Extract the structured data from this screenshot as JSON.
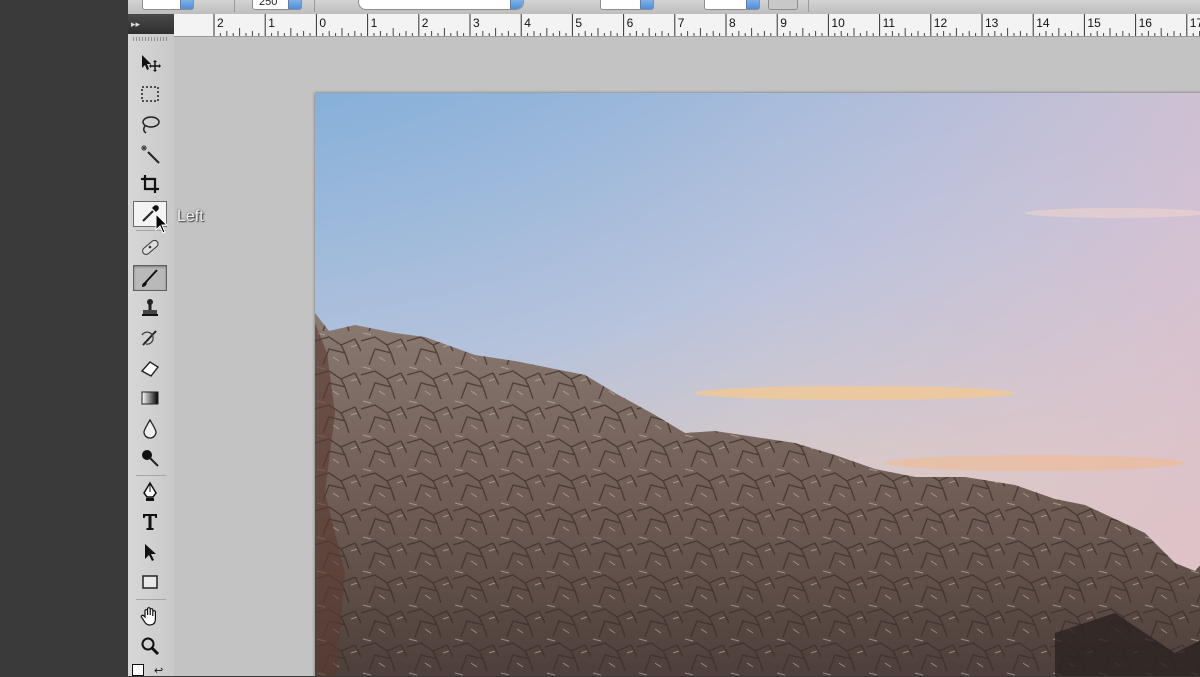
{
  "options_bar": {
    "brush_size_value": "250"
  },
  "ruler": {
    "unit": "inches",
    "labels": [
      "2",
      "1",
      "0",
      "1",
      "2",
      "3",
      "4",
      "5",
      "6",
      "7",
      "8",
      "9",
      "10",
      "11",
      "12",
      "13",
      "14",
      "15",
      "16",
      "17"
    ]
  },
  "toolbox": {
    "tools": [
      {
        "name": "move-tool",
        "icon": "move-icon",
        "state": "normal"
      },
      {
        "name": "marquee-tool",
        "icon": "rect-marquee-icon",
        "state": "normal"
      },
      {
        "name": "lasso-tool",
        "icon": "lasso-icon",
        "state": "normal"
      },
      {
        "name": "magic-wand-tool",
        "icon": "magic-wand-icon",
        "state": "normal"
      },
      {
        "name": "crop-tool",
        "icon": "crop-icon",
        "state": "normal"
      },
      {
        "name": "eyedropper-tool",
        "icon": "eyedropper-icon",
        "state": "hover"
      },
      {
        "name": "healing-brush-tool",
        "icon": "bandage-icon",
        "state": "normal"
      },
      {
        "name": "brush-tool",
        "icon": "brush-icon",
        "state": "active"
      },
      {
        "name": "clone-stamp-tool",
        "icon": "stamp-icon",
        "state": "normal"
      },
      {
        "name": "history-brush-tool",
        "icon": "history-brush-icon",
        "state": "normal"
      },
      {
        "name": "eraser-tool",
        "icon": "eraser-icon",
        "state": "normal"
      },
      {
        "name": "gradient-tool",
        "icon": "gradient-icon",
        "state": "normal"
      },
      {
        "name": "blur-tool",
        "icon": "droplet-icon",
        "state": "normal"
      },
      {
        "name": "dodge-tool",
        "icon": "dodge-icon",
        "state": "normal"
      },
      {
        "name": "pen-tool",
        "icon": "pen-icon",
        "state": "normal"
      },
      {
        "name": "type-tool",
        "icon": "type-icon",
        "state": "normal"
      },
      {
        "name": "path-selection-tool",
        "icon": "arrow-icon",
        "state": "normal"
      },
      {
        "name": "shape-tool",
        "icon": "rectangle-icon",
        "state": "normal"
      },
      {
        "name": "hand-tool",
        "icon": "hand-icon",
        "state": "normal"
      },
      {
        "name": "zoom-tool",
        "icon": "magnifier-icon",
        "state": "normal"
      }
    ]
  },
  "tooltip": {
    "text": "Left"
  },
  "colors": {
    "workspace": "#c3c3c3",
    "sky_top": "#8cb3da",
    "sky_warm": "#f3c59a",
    "rock": "#7d6b62"
  }
}
